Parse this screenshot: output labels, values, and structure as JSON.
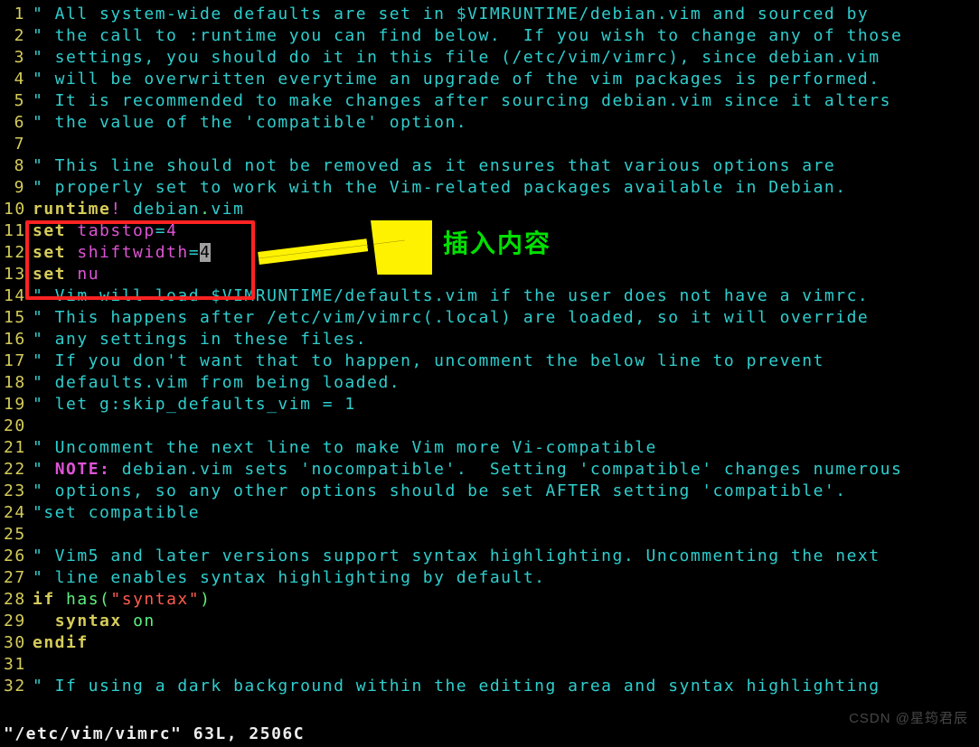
{
  "annotation": {
    "label": "插入内容"
  },
  "status": "\"/etc/vim/vimrc\" 63L, 2506C",
  "watermark": "CSDN @星筠君辰",
  "cursor": {
    "line": 12,
    "char": "4"
  },
  "lines": [
    {
      "n": 1,
      "segs": [
        {
          "c": "c-comment",
          "t": "\" All system-wide defaults are set in $VIMRUNTIME/debian.vim and sourced by"
        }
      ]
    },
    {
      "n": 2,
      "segs": [
        {
          "c": "c-comment",
          "t": "\" the call to :runtime you can find below.  If you wish to change any of those"
        }
      ]
    },
    {
      "n": 3,
      "segs": [
        {
          "c": "c-comment",
          "t": "\" settings, you should do it in this file (/etc/vim/vimrc), since debian.vim"
        }
      ]
    },
    {
      "n": 4,
      "segs": [
        {
          "c": "c-comment",
          "t": "\" will be overwritten everytime an upgrade of the vim packages is performed."
        }
      ]
    },
    {
      "n": 5,
      "segs": [
        {
          "c": "c-comment",
          "t": "\" It is recommended to make changes after sourcing debian.vim since it alters"
        }
      ]
    },
    {
      "n": 6,
      "segs": [
        {
          "c": "c-comment",
          "t": "\" the value of the 'compatible' option."
        }
      ]
    },
    {
      "n": 7,
      "segs": [
        {
          "c": "c-comment",
          "t": ""
        }
      ]
    },
    {
      "n": 8,
      "segs": [
        {
          "c": "c-comment",
          "t": "\" This line should not be removed as it ensures that various options are"
        }
      ]
    },
    {
      "n": 9,
      "segs": [
        {
          "c": "c-comment",
          "t": "\" properly set to work with the Vim-related packages available in Debian."
        }
      ]
    },
    {
      "n": 10,
      "segs": [
        {
          "c": "c-key",
          "t": "runtime"
        },
        {
          "c": "c-command",
          "t": "!"
        },
        {
          "c": "",
          "t": " debian"
        },
        {
          "c": "c-green",
          "t": "."
        },
        {
          "c": "",
          "t": "vim"
        }
      ]
    },
    {
      "n": 11,
      "segs": [
        {
          "c": "c-key",
          "t": "set"
        },
        {
          "c": "",
          "t": " "
        },
        {
          "c": "c-option",
          "t": "tabstop"
        },
        {
          "c": "",
          "t": "="
        },
        {
          "c": "c-num",
          "t": "4"
        }
      ]
    },
    {
      "n": 12,
      "segs": [
        {
          "c": "c-key",
          "t": "set"
        },
        {
          "c": "",
          "t": " "
        },
        {
          "c": "c-option",
          "t": "shiftwidth"
        },
        {
          "c": "",
          "t": "="
        },
        {
          "c": "cursor-cell",
          "t": "4"
        }
      ]
    },
    {
      "n": 13,
      "segs": [
        {
          "c": "c-key",
          "t": "set"
        },
        {
          "c": "",
          "t": " "
        },
        {
          "c": "c-option",
          "t": "nu"
        }
      ]
    },
    {
      "n": 14,
      "segs": [
        {
          "c": "c-comment",
          "t": "\" Vim will load $VIMRUNTIME/defaults.vim if the user does not have a vimrc."
        }
      ]
    },
    {
      "n": 15,
      "segs": [
        {
          "c": "c-comment",
          "t": "\" This happens after /etc/vim/vimrc(.local) are loaded, so it will override"
        }
      ]
    },
    {
      "n": 16,
      "segs": [
        {
          "c": "c-comment",
          "t": "\" any settings in these files."
        }
      ]
    },
    {
      "n": 17,
      "segs": [
        {
          "c": "c-comment",
          "t": "\" If you don't want that to happen, uncomment the below line to prevent"
        }
      ]
    },
    {
      "n": 18,
      "segs": [
        {
          "c": "c-comment",
          "t": "\" defaults.vim from being loaded."
        }
      ]
    },
    {
      "n": 19,
      "segs": [
        {
          "c": "c-comment",
          "t": "\" let g:skip_defaults_vim = 1"
        }
      ]
    },
    {
      "n": 20,
      "segs": [
        {
          "c": "c-comment",
          "t": ""
        }
      ]
    },
    {
      "n": 21,
      "segs": [
        {
          "c": "c-comment",
          "t": "\" Uncomment the next line to make Vim more Vi-compatible"
        }
      ]
    },
    {
      "n": 22,
      "segs": [
        {
          "c": "c-comment",
          "t": "\" "
        },
        {
          "c": "c-note",
          "t": "NOTE:"
        },
        {
          "c": "c-comment",
          "t": " debian.vim sets 'nocompatible'.  Setting 'compatible' changes numerous"
        }
      ]
    },
    {
      "n": 23,
      "segs": [
        {
          "c": "c-comment",
          "t": "\" options, so any other options should be set AFTER setting 'compatible'."
        }
      ]
    },
    {
      "n": 24,
      "segs": [
        {
          "c": "c-comment",
          "t": "\"set compatible"
        }
      ]
    },
    {
      "n": 25,
      "segs": [
        {
          "c": "c-comment",
          "t": ""
        }
      ]
    },
    {
      "n": 26,
      "segs": [
        {
          "c": "c-comment",
          "t": "\" Vim5 and later versions support syntax highlighting. Uncommenting the next"
        }
      ]
    },
    {
      "n": 27,
      "segs": [
        {
          "c": "c-comment",
          "t": "\" line enables syntax highlighting by default."
        }
      ]
    },
    {
      "n": 28,
      "segs": [
        {
          "c": "c-key",
          "t": "if"
        },
        {
          "c": "",
          "t": " "
        },
        {
          "c": "c-func",
          "t": "has"
        },
        {
          "c": "c-green",
          "t": "("
        },
        {
          "c": "c-str",
          "t": "\"syntax\""
        },
        {
          "c": "c-green",
          "t": ")"
        }
      ]
    },
    {
      "n": 29,
      "segs": [
        {
          "c": "",
          "t": "  "
        },
        {
          "c": "c-key",
          "t": "syntax"
        },
        {
          "c": "",
          "t": " "
        },
        {
          "c": "c-green",
          "t": "on"
        }
      ]
    },
    {
      "n": 30,
      "segs": [
        {
          "c": "c-key",
          "t": "endif"
        }
      ]
    },
    {
      "n": 31,
      "segs": [
        {
          "c": "c-comment",
          "t": ""
        }
      ]
    },
    {
      "n": 32,
      "segs": [
        {
          "c": "c-comment",
          "t": "\" If using a dark background within the editing area and syntax highlighting"
        }
      ]
    }
  ]
}
